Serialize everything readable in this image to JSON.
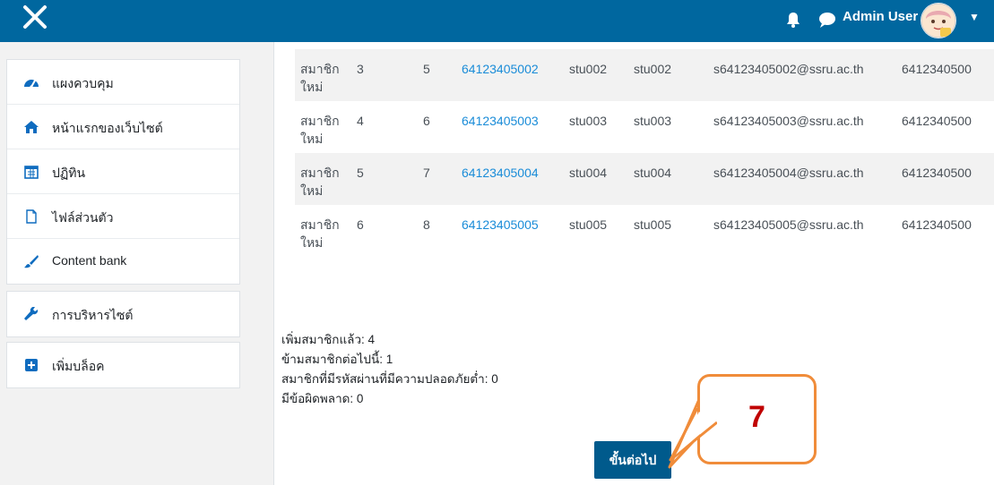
{
  "topbar": {
    "close_icon": "close-icon",
    "user_name": "Admin User",
    "icons": [
      "bell-icon",
      "chat-icon",
      "caret-down-icon"
    ]
  },
  "drawer": {
    "group1": [
      {
        "icon": "dashboard-icon",
        "label": "แผงควบคุม"
      },
      {
        "icon": "home-icon",
        "label": "หน้าแรกของเว็บไซต์"
      },
      {
        "icon": "calendar-icon",
        "label": "ปฏิทิน"
      },
      {
        "icon": "file-icon",
        "label": "ไฟล์ส่วนตัว"
      },
      {
        "icon": "brush-icon",
        "label": "Content bank"
      }
    ],
    "group2": [
      {
        "icon": "wrench-icon",
        "label": "การบริหารไซต์"
      }
    ],
    "group3": [
      {
        "icon": "plus-square-icon",
        "label": "เพิ่มบล็อค"
      }
    ]
  },
  "table": {
    "rows": [
      {
        "status": "สมาชิกใหม่",
        "line": "3",
        "id": "5",
        "username": "64123405002",
        "firstname": "stu002",
        "lastname": "stu002",
        "email": "s64123405002@ssru.ac.th",
        "idnumber": "6412340500"
      },
      {
        "status": "สมาชิกใหม่",
        "line": "4",
        "id": "6",
        "username": "64123405003",
        "firstname": "stu003",
        "lastname": "stu003",
        "email": "s64123405003@ssru.ac.th",
        "idnumber": "6412340500"
      },
      {
        "status": "สมาชิกใหม่",
        "line": "5",
        "id": "7",
        "username": "64123405004",
        "firstname": "stu004",
        "lastname": "stu004",
        "email": "s64123405004@ssru.ac.th",
        "idnumber": "6412340500"
      },
      {
        "status": "สมาชิกใหม่",
        "line": "6",
        "id": "8",
        "username": "64123405005",
        "firstname": "stu005",
        "lastname": "stu005",
        "email": "s64123405005@ssru.ac.th",
        "idnumber": "6412340500"
      }
    ]
  },
  "summary": {
    "added": "เพิ่มสมาชิกแล้ว: 4",
    "skipped": "ข้ามสมาชิกต่อไปนี้: 1",
    "weak_passwords": "สมาชิกที่มีรหัสผ่านที่มีความปลอดภัยต่ำ: 0",
    "errors": "มีข้อผิดพลาด: 0"
  },
  "continue_button": "ขั้นต่อไป",
  "callout": {
    "number": "7",
    "color": "#f08c3a",
    "number_color": "#c00000"
  }
}
